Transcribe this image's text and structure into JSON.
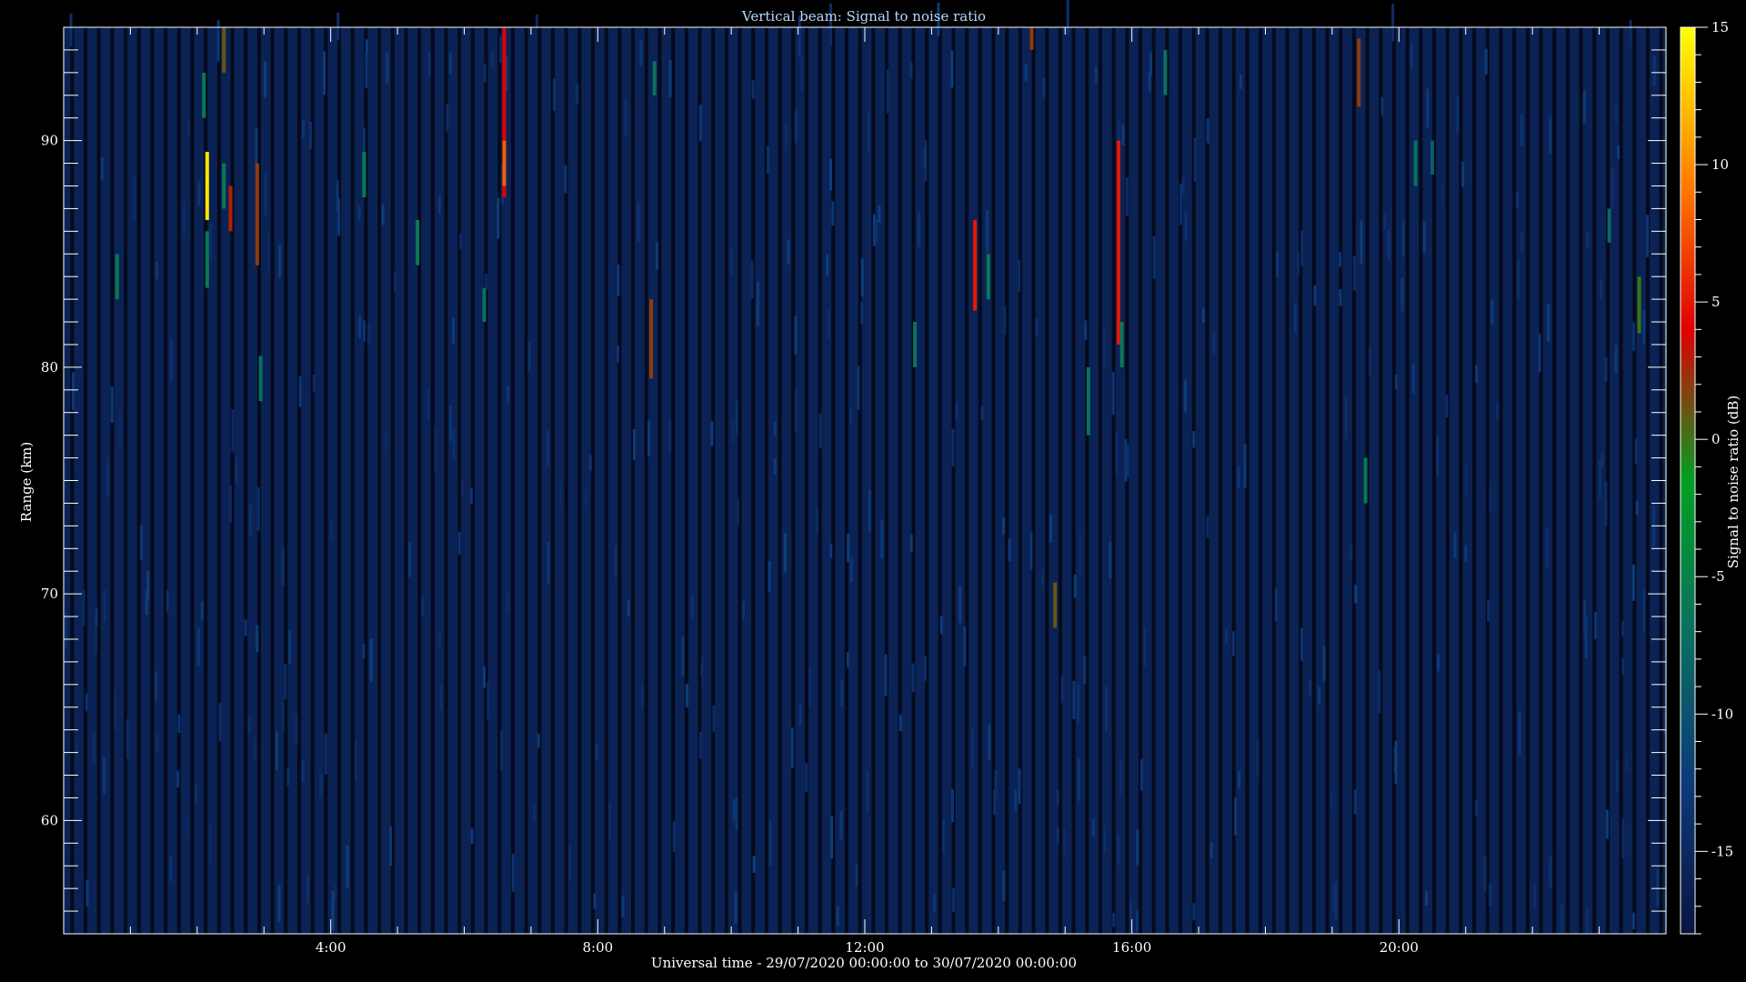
{
  "chart_data": {
    "type": "heatmap",
    "title": "Vertical beam: Signal to noise ratio",
    "xlabel": "Universal time - 29/07/2020 00:00:00 to 30/07/2020 00:00:00",
    "ylabel": "Range (km)",
    "colorbar_label": "Signal to noise ratio (dB)",
    "x_tick_labels": [
      "4:00",
      "8:00",
      "12:00",
      "16:00",
      "20:00"
    ],
    "x_tick_hours": [
      4,
      8,
      12,
      16,
      20
    ],
    "xlim_hours": [
      0,
      24
    ],
    "y_ticks": [
      60,
      70,
      80,
      90
    ],
    "ylim": [
      55,
      95
    ],
    "colorbar_ticks": [
      -15,
      -10,
      -5,
      0,
      5,
      10,
      15
    ],
    "colorbar_range": [
      -18,
      15
    ],
    "background_snr_db": -16,
    "grid": false,
    "colormap": [
      "#0a1440",
      "#0d3a7a",
      "#0a7060",
      "#00a020",
      "#e00000",
      "#ff8000",
      "#ffff00"
    ],
    "notable_echoes": [
      {
        "hour": 0.8,
        "range_from": 83,
        "range_to": 85,
        "snr": -6
      },
      {
        "hour": 2.1,
        "range_from": 91,
        "range_to": 93,
        "snr": -6
      },
      {
        "hour": 2.15,
        "range_from": 86.5,
        "range_to": 89.5,
        "snr": 14
      },
      {
        "hour": 2.15,
        "range_from": 83.5,
        "range_to": 86,
        "snr": -6
      },
      {
        "hour": 2.4,
        "range_from": 93,
        "range_to": 95,
        "snr": 1
      },
      {
        "hour": 2.4,
        "range_from": 87,
        "range_to": 89,
        "snr": -6
      },
      {
        "hour": 2.5,
        "range_from": 86,
        "range_to": 88,
        "snr": 3
      },
      {
        "hour": 2.9,
        "range_from": 84.5,
        "range_to": 89,
        "snr": 2
      },
      {
        "hour": 2.95,
        "range_from": 78.5,
        "range_to": 80.5,
        "snr": -7
      },
      {
        "hour": 4.5,
        "range_from": 87.5,
        "range_to": 89.5,
        "snr": -6
      },
      {
        "hour": 5.3,
        "range_from": 84.5,
        "range_to": 86.5,
        "snr": -6
      },
      {
        "hour": 6.3,
        "range_from": 82,
        "range_to": 83.5,
        "snr": -7
      },
      {
        "hour": 6.6,
        "range_from": 87.5,
        "range_to": 95,
        "snr": 4
      },
      {
        "hour": 6.6,
        "range_from": 88,
        "range_to": 90,
        "snr": 8
      },
      {
        "hour": 8.8,
        "range_from": 79.5,
        "range_to": 83,
        "snr": 2
      },
      {
        "hour": 8.85,
        "range_from": 92,
        "range_to": 93.5,
        "snr": -7
      },
      {
        "hour": 12.75,
        "range_from": 80,
        "range_to": 82,
        "snr": -7
      },
      {
        "hour": 13.65,
        "range_from": 82.5,
        "range_to": 86.5,
        "snr": 5
      },
      {
        "hour": 13.85,
        "range_from": 83,
        "range_to": 85,
        "snr": -6
      },
      {
        "hour": 14.5,
        "range_from": 94,
        "range_to": 95,
        "snr": 2
      },
      {
        "hour": 14.85,
        "range_from": 68.5,
        "range_to": 70.5,
        "snr": 1
      },
      {
        "hour": 15.35,
        "range_from": 77,
        "range_to": 80,
        "snr": -7
      },
      {
        "hour": 15.8,
        "range_from": 81,
        "range_to": 90,
        "snr": 5
      },
      {
        "hour": 15.85,
        "range_from": 80,
        "range_to": 82,
        "snr": -6
      },
      {
        "hour": 16.5,
        "range_from": 92,
        "range_to": 94,
        "snr": -7
      },
      {
        "hour": 19.4,
        "range_from": 91.5,
        "range_to": 94.5,
        "snr": 2
      },
      {
        "hour": 19.5,
        "range_from": 74,
        "range_to": 76,
        "snr": -6
      },
      {
        "hour": 20.25,
        "range_from": 88,
        "range_to": 90,
        "snr": -7
      },
      {
        "hour": 20.5,
        "range_from": 88.5,
        "range_to": 90,
        "snr": -9
      },
      {
        "hour": 23.15,
        "range_from": 85.5,
        "range_to": 87,
        "snr": -8
      },
      {
        "hour": 23.6,
        "range_from": 81.5,
        "range_to": 84,
        "snr": 0
      }
    ]
  }
}
